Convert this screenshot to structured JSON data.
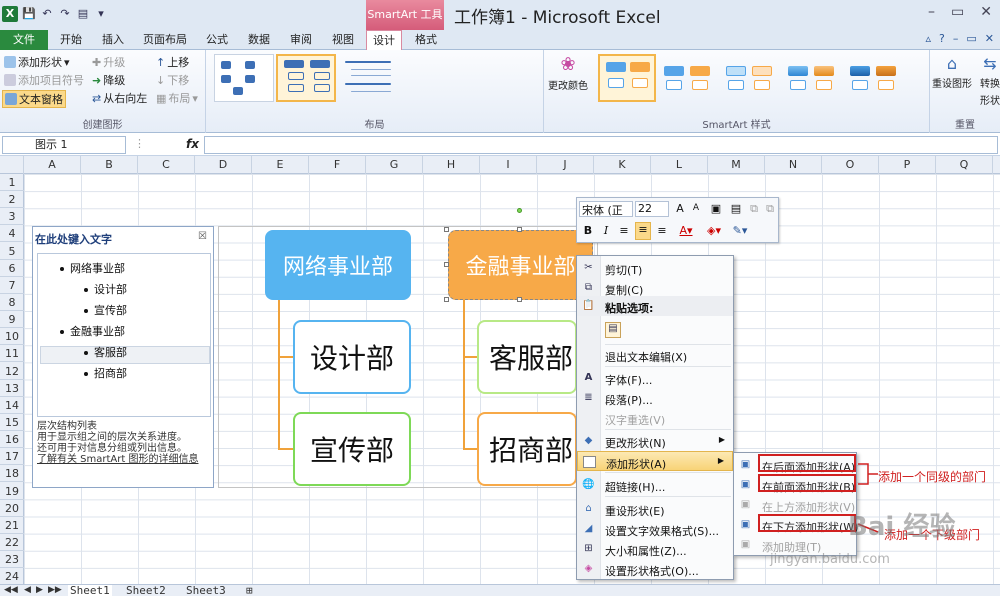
{
  "app": {
    "title": "工作簿1 - Microsoft Excel",
    "context_tool": "SmartArt 工具",
    "window_buttons": [
      "–",
      "▭",
      "✕"
    ]
  },
  "tabs": [
    "文件",
    "开始",
    "插入",
    "页面布局",
    "公式",
    "数据",
    "审阅",
    "视图",
    "设计",
    "格式"
  ],
  "ribbon": {
    "create_graphic": {
      "title": "创建图形",
      "add_shape": "添加形状",
      "add_bullet": "添加项目符号",
      "text_pane": "文本窗格",
      "promote": "升级",
      "demote": "降级",
      "right_to_left": "从右向左",
      "move_up": "上移",
      "move_down": "下移",
      "layout": "布局"
    },
    "layouts": {
      "title": "布局"
    },
    "styles": {
      "title": "SmartArt 样式",
      "change_colors": "更改颜色"
    },
    "reset": {
      "title": "重置",
      "reset_graphic": "重设图形",
      "convert": "转换",
      "convert2": "形状"
    }
  },
  "formula_bar": {
    "name_box": "图示 1",
    "fx": "fx"
  },
  "columns": [
    "A",
    "B",
    "C",
    "D",
    "E",
    "F",
    "G",
    "H",
    "I",
    "J",
    "K",
    "L",
    "M",
    "N",
    "O",
    "P",
    "Q"
  ],
  "rows": [
    "1",
    "2",
    "3",
    "4",
    "5",
    "6",
    "7",
    "8",
    "9",
    "10",
    "11",
    "12",
    "13",
    "14",
    "15",
    "16",
    "17",
    "18",
    "19",
    "20",
    "21",
    "22",
    "23",
    "24"
  ],
  "sheets": [
    "Sheet1",
    "Sheet2",
    "Sheet3"
  ],
  "text_pane": {
    "header": "在此处键入文字",
    "close": "☒",
    "items": [
      {
        "level": 1,
        "text": "网络事业部"
      },
      {
        "level": 2,
        "text": "设计部"
      },
      {
        "level": 2,
        "text": "宣传部"
      },
      {
        "level": 1,
        "text": "金融事业部"
      },
      {
        "level": 2,
        "text": "客服部"
      },
      {
        "level": 2,
        "text": "招商部"
      }
    ],
    "desc_title": "层次结构列表",
    "desc_line1": "用于显示组之间的层次关系进度。",
    "desc_line2": "还可用于对信息分组或列出信息。",
    "desc_link": "了解有关 SmartArt 图形的详细信息"
  },
  "smartart": {
    "top_left": "网络事业部",
    "top_right": "金融事业部",
    "left_children": [
      "设计部",
      "宣传部"
    ],
    "right_children": [
      "客服部",
      "招商部"
    ],
    "colors": {
      "blue": "#56b4f0",
      "orange": "#f7a948",
      "child_border_left1": "#56b4f0",
      "child_border_left2": "#7ed957",
      "child_border_right1": "#b8e986",
      "child_border_right2": "#f7a948"
    }
  },
  "mini_toolbar": {
    "font": "宋体 (正",
    "size": "22",
    "grow": "A",
    "shrink": "A",
    "bold": "B",
    "italic": "I"
  },
  "context_menu": {
    "cut": "剪切(T)",
    "copy": "复制(C)",
    "paste_options": "粘贴选项:",
    "exit_edit": "退出文本编辑(X)",
    "font": "字体(F)...",
    "paragraph": "段落(P)...",
    "reconvert": "汉字重选(V)",
    "change_shape": "更改形状(N)",
    "add_shape": "添加形状(A)",
    "hyperlink": "超链接(H)...",
    "reset_shape": "重设形状(E)",
    "text_effects": "设置文字效果格式(S)...",
    "size_props": "大小和属性(Z)...",
    "format_shape": "设置形状格式(O)..."
  },
  "submenu": {
    "add_after": "在后面添加形状(A)",
    "add_before": "在前面添加形状(B)",
    "add_above": "在上方添加形状(V)",
    "add_below": "在下方添加形状(W)",
    "add_assistant": "添加助理(T)"
  },
  "annotations": {
    "same_level": "添加一个同级的部门",
    "sub_level": "添加一个下级部门"
  },
  "watermark": {
    "text1": "Bai 经验",
    "text2": "jingyan.baidu.com"
  }
}
